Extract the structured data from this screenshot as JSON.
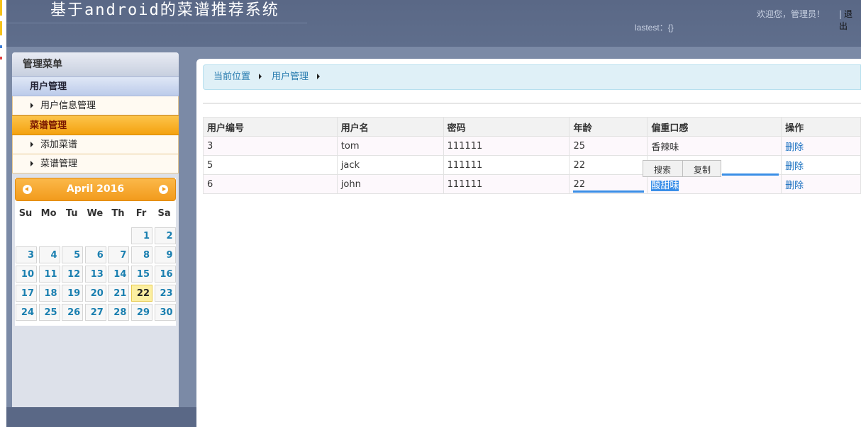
{
  "header": {
    "title": "基于android的菜谱推荐系统",
    "lastest": "lastest：{}",
    "welcome": "欢迎您，管理员！",
    "logout": "退出"
  },
  "sidebar": {
    "title": "管理菜单",
    "groups": [
      {
        "label": "用户管理",
        "items": [
          {
            "label": "用户信息管理"
          }
        ]
      },
      {
        "label": "菜谱管理",
        "items": [
          {
            "label": "添加菜谱"
          },
          {
            "label": "菜谱管理"
          }
        ]
      }
    ]
  },
  "calendar": {
    "month_label": "April 2016",
    "weekdays": [
      "Su",
      "Mo",
      "Tu",
      "We",
      "Th",
      "Fr",
      "Sa"
    ],
    "first_weekday": 5,
    "days": 30,
    "today": 22
  },
  "breadcrumb": [
    "当前位置",
    "用户管理"
  ],
  "table": {
    "headers": [
      "用户编号",
      "用户名",
      "密码",
      "年龄",
      "偏重口感",
      "操作"
    ],
    "rows": [
      [
        "3",
        "tom",
        "111111",
        "25",
        "香辣味",
        "删除"
      ],
      [
        "5",
        "jack",
        "111111",
        "22",
        "",
        "删除"
      ],
      [
        "6",
        "john",
        "111111",
        "22",
        "酸甜味",
        "删除"
      ]
    ]
  },
  "context_menu": {
    "search": "搜索",
    "copy": "复制"
  },
  "colors": {
    "header_bg": "#5a6886",
    "calendar_accent": "#f29b1c",
    "link": "#1a70c0",
    "selection": "#3b8fe8"
  }
}
